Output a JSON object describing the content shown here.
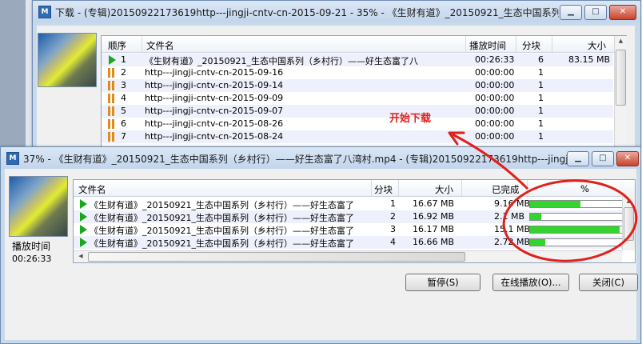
{
  "back_window": {
    "app_icon": "app-logo-icon",
    "title": "下载 - (专辑)20150922173619http---jingji-cntv-cn-2015-09-21 - 35% - 《生财有道》_20150921_生态中国系列（",
    "columns": [
      "顺序",
      "文件名",
      "播放时间",
      "分块",
      "大小"
    ],
    "rows": [
      {
        "num": "1",
        "status": "play",
        "name": "《生财有道》_20150921_生态中国系列（乡村行）——好生态富了八",
        "time": "00:26:33",
        "blocks": "6",
        "size": "83.15 MB"
      },
      {
        "num": "2",
        "status": "pause",
        "name": "http---jingji-cntv-cn-2015-09-16",
        "time": "00:00:00",
        "blocks": "1",
        "size": ""
      },
      {
        "num": "3",
        "status": "pause",
        "name": "http---jingji-cntv-cn-2015-09-14",
        "time": "00:00:00",
        "blocks": "1",
        "size": ""
      },
      {
        "num": "4",
        "status": "pause",
        "name": "http---jingji-cntv-cn-2015-09-09",
        "time": "00:00:00",
        "blocks": "1",
        "size": ""
      },
      {
        "num": "5",
        "status": "pause",
        "name": "http---jingji-cntv-cn-2015-09-07",
        "time": "00:00:00",
        "blocks": "1",
        "size": ""
      },
      {
        "num": "6",
        "status": "pause",
        "name": "http---jingji-cntv-cn-2015-08-26",
        "time": "00:00:00",
        "blocks": "1",
        "size": ""
      },
      {
        "num": "7",
        "status": "pause",
        "name": "http---jingji-cntv-cn-2015-08-24",
        "time": "00:00:00",
        "blocks": "1",
        "size": ""
      }
    ]
  },
  "front_window": {
    "app_icon": "app-logo-icon",
    "title": "37% - 《生财有道》_20150921_生态中国系列（乡村行）——好生态富了八湾村.mp4 - (专辑)20150922173619http---jingji-",
    "play_time_label": "播放时间",
    "play_time_value": "00:26:33",
    "columns": [
      "文件名",
      "分块",
      "大小",
      "已完成",
      "%"
    ],
    "rows": [
      {
        "name": "《生财有道》_20150921_生态中国系列（乡村行）——好生态富了",
        "block": "1",
        "size": "16.67 MB",
        "done": "9.16 MB",
        "progress": 0.55
      },
      {
        "name": "《生财有道》_20150921_生态中国系列（乡村行）——好生态富了",
        "block": "2",
        "size": "16.92 MB",
        "done": "2.1 MB",
        "progress": 0.12
      },
      {
        "name": "《生财有道》_20150921_生态中国系列（乡村行）——好生态富了",
        "block": "3",
        "size": "16.17 MB",
        "done": "15.1 MB",
        "progress": 0.98
      },
      {
        "name": "《生财有道》_20150921_生态中国系列（乡村行）——好生态富了",
        "block": "4",
        "size": "16.66 MB",
        "done": "2.72 MB",
        "progress": 0.17
      }
    ],
    "buttons": {
      "pause": "暂停(S)",
      "online_play": "在线播放(O)...",
      "close": "关闭(C)"
    }
  },
  "annotation": {
    "label": "开始下载",
    "color": "#e0201a"
  }
}
